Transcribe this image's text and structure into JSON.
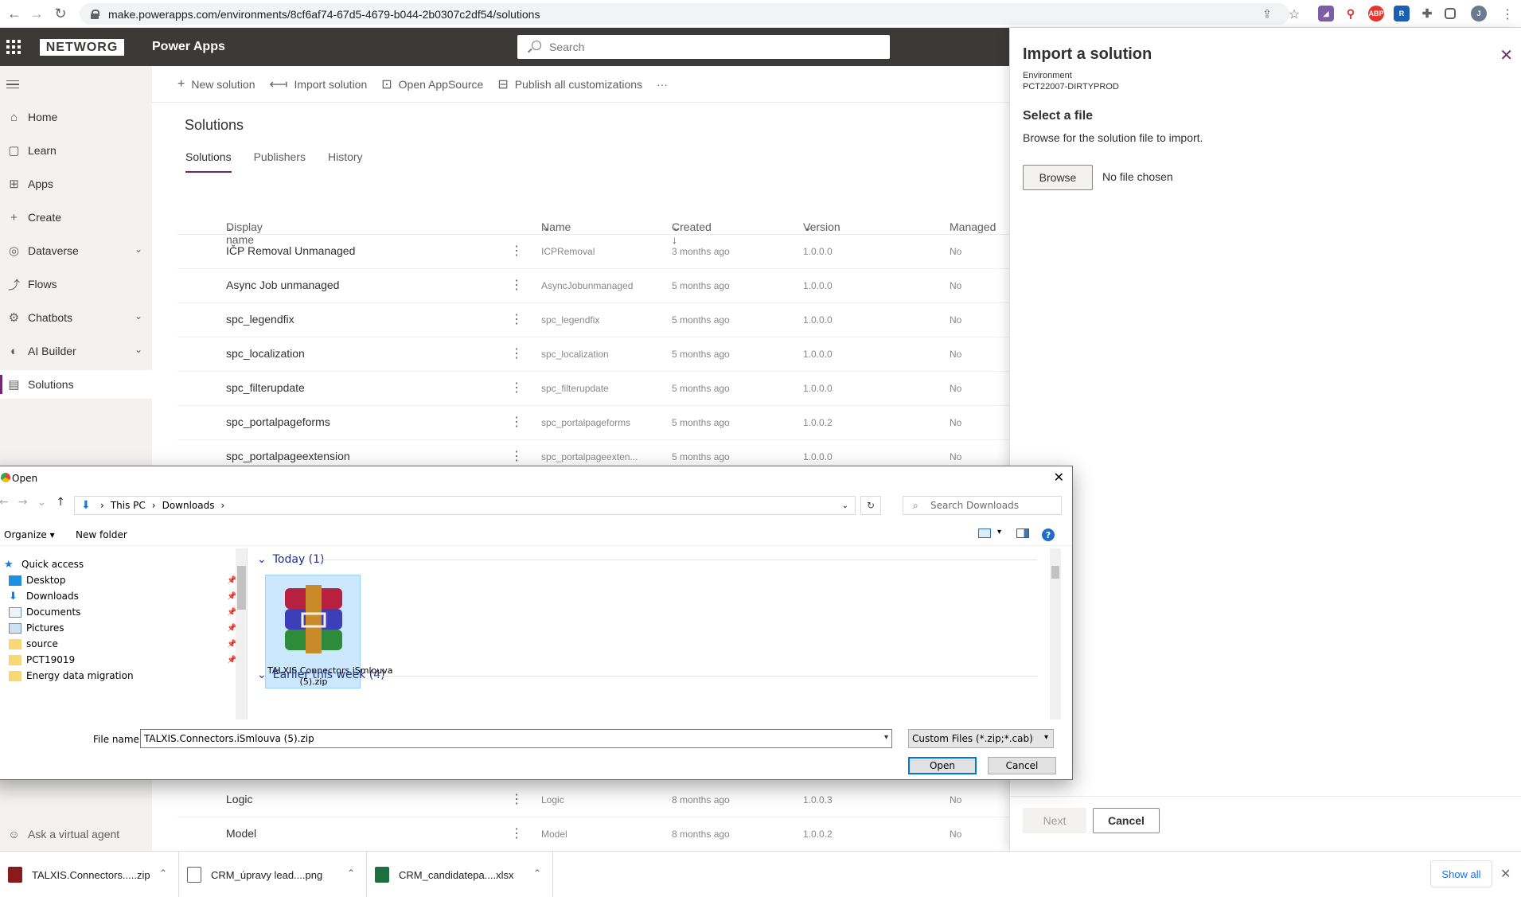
{
  "browser": {
    "url": "make.powerapps.com/environments/8cf6af74-67d5-4679-b044-2b0307c2df54/solutions",
    "extensions": [
      "ABP"
    ],
    "profile_initial": "J"
  },
  "header": {
    "org_logo": "NETWORG",
    "app_title": "Power Apps",
    "search_placeholder": "Search"
  },
  "sidebar": {
    "items": [
      {
        "label": "Home",
        "icon": "home-icon"
      },
      {
        "label": "Learn",
        "icon": "book-icon"
      },
      {
        "label": "Apps",
        "icon": "apps-icon"
      },
      {
        "label": "Create",
        "icon": "plus-icon"
      },
      {
        "label": "Dataverse",
        "icon": "database-icon"
      },
      {
        "label": "Flows",
        "icon": "flow-icon"
      },
      {
        "label": "Chatbots",
        "icon": "chatbot-icon"
      },
      {
        "label": "AI Builder",
        "icon": "ai-builder-icon"
      },
      {
        "label": "Solutions",
        "icon": "solutions-icon"
      }
    ],
    "selected": "Solutions",
    "virtual_agent": "Ask a virtual agent"
  },
  "commandbar": {
    "new_solution": "New solution",
    "import_solution": "Import solution",
    "open_appsource": "Open AppSource",
    "publish_all": "Publish all customizations",
    "more": "···"
  },
  "page": {
    "title": "Solutions",
    "tabs": [
      "Solutions",
      "Publishers",
      "History"
    ]
  },
  "table": {
    "columns": [
      "Display name",
      "Name",
      "Created ↓",
      "Version",
      "Managed"
    ],
    "rows": [
      {
        "display": "IČP Removal Unmanaged",
        "name": "ICPRemoval",
        "created": "3 months ago",
        "version": "1.0.0.0",
        "managed": "No"
      },
      {
        "display": "Async Job unmanaged",
        "name": "AsyncJobunmanaged",
        "created": "5 months ago",
        "version": "1.0.0.0",
        "managed": "No"
      },
      {
        "display": "spc_legendfix",
        "name": "spc_legendfix",
        "created": "5 months ago",
        "version": "1.0.0.0",
        "managed": "No"
      },
      {
        "display": "spc_localization",
        "name": "spc_localization",
        "created": "5 months ago",
        "version": "1.0.0.0",
        "managed": "No"
      },
      {
        "display": "spc_filterupdate",
        "name": "spc_filterupdate",
        "created": "5 months ago",
        "version": "1.0.0.0",
        "managed": "No"
      },
      {
        "display": "spc_portalpageforms",
        "name": "spc_portalpageforms",
        "created": "5 months ago",
        "version": "1.0.0.2",
        "managed": "No"
      },
      {
        "display": "spc_portalpageextension",
        "name": "spc_portalpageexten...",
        "created": "5 months ago",
        "version": "1.0.0.0",
        "managed": "No"
      },
      {
        "display": "Logic",
        "name": "Logic",
        "created": "8 months ago",
        "version": "1.0.0.3",
        "managed": "No"
      },
      {
        "display": "Model",
        "name": "Model",
        "created": "8 months ago",
        "version": "1.0.0.2",
        "managed": "No"
      }
    ]
  },
  "panel": {
    "title": "Import a solution",
    "env_label": "Environment",
    "env_value": "PCT22007-DIRTYPROD",
    "select_header": "Select a file",
    "select_desc": "Browse for the solution file to import.",
    "browse": "Browse",
    "no_file": "No file chosen",
    "next": "Next",
    "cancel": "Cancel"
  },
  "dialog": {
    "title": "Open",
    "breadcrumb": [
      "This PC",
      "Downloads"
    ],
    "search_placeholder": "Search Downloads",
    "organize": "Organize ▾",
    "new_folder": "New folder",
    "tree": [
      {
        "label": "Quick access",
        "icon": "star-icon"
      },
      {
        "label": "Desktop",
        "icon": "desktop-icon"
      },
      {
        "label": "Downloads",
        "icon": "download-icon"
      },
      {
        "label": "Documents",
        "icon": "documents-icon"
      },
      {
        "label": "Pictures",
        "icon": "pictures-icon"
      },
      {
        "label": "source",
        "icon": "folder-icon"
      },
      {
        "label": "PCT19019",
        "icon": "folder-icon"
      },
      {
        "label": "Energy data migration",
        "icon": "folder-icon"
      }
    ],
    "group_today": "Today (1)",
    "group_earlier": "Earlier this week (4)",
    "file_name_display": "TALXIS.Connectors.iSmlouva (5).zip",
    "file_label": "File name:",
    "file_value": "TALXIS.Connectors.iSmlouva (5).zip",
    "file_type": "Custom Files (*.zip;*.cab)",
    "open": "Open",
    "cancel": "Cancel"
  },
  "downloads": {
    "items": [
      {
        "name": "TALXIS.Connectors.....zip",
        "color": "#8b1a1a"
      },
      {
        "name": "CRM_úpravy lead....png",
        "color": "#5f6368"
      },
      {
        "name": "CRM_candidatepa....xlsx",
        "color": "#1d6f42"
      }
    ],
    "show_all": "Show all"
  }
}
